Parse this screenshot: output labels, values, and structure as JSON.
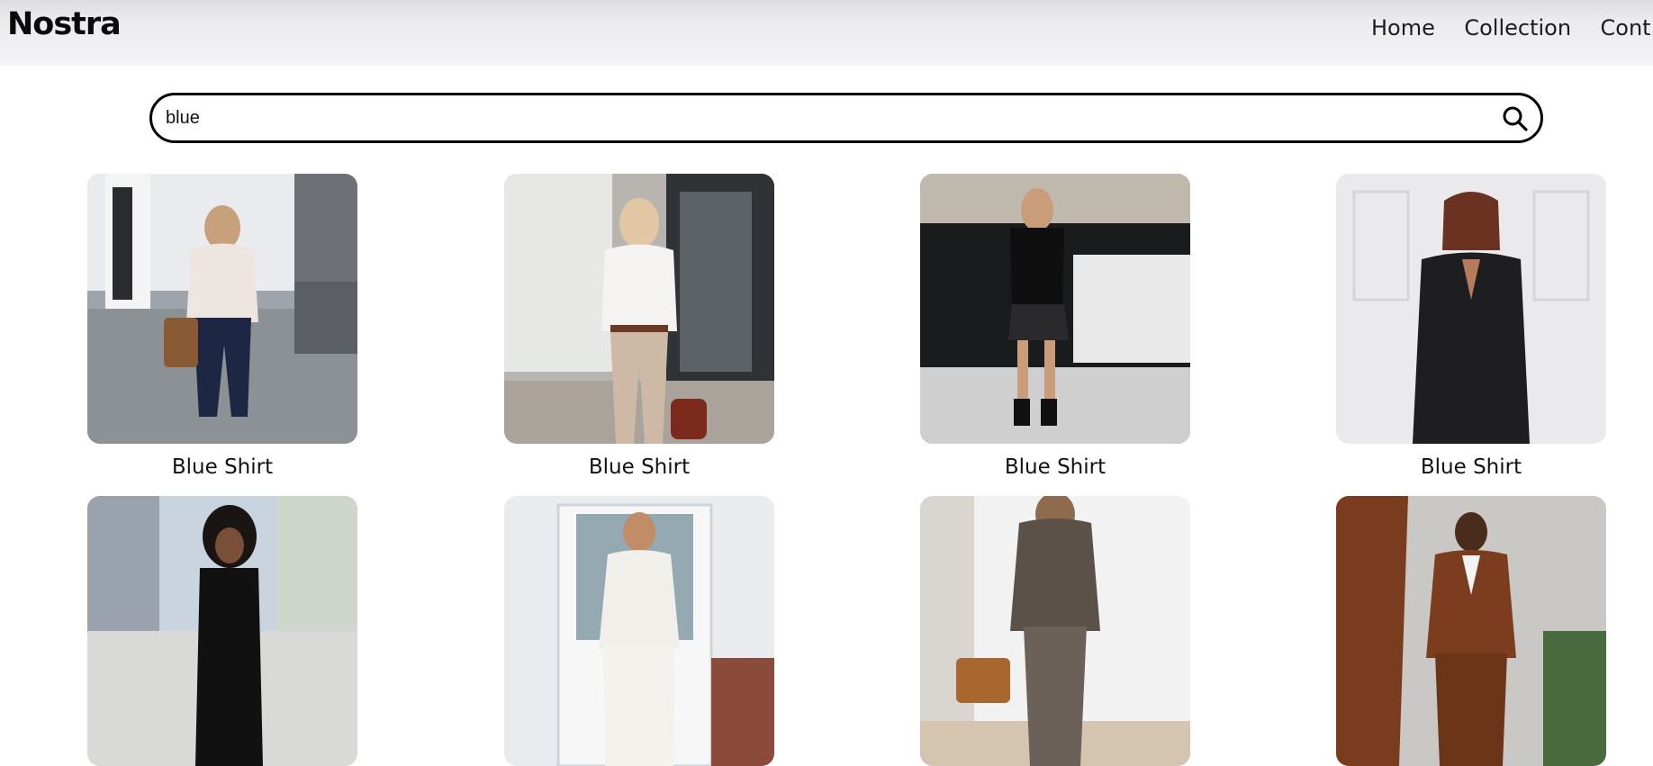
{
  "header": {
    "brand": "Nostra",
    "nav": [
      {
        "label": "Home"
      },
      {
        "label": "Collection"
      },
      {
        "label": "Cont"
      }
    ]
  },
  "search": {
    "value": "blue",
    "icon": "search-icon"
  },
  "products": [
    {
      "title": "Blue Shirt",
      "image": "woman in white blouse and navy trousers with brown handbag"
    },
    {
      "title": "Blue Shirt",
      "image": "blonde woman in white shirt and beige trousers with red bag"
    },
    {
      "title": "Blue Shirt",
      "image": "woman in black top and leather skirt by white car"
    },
    {
      "title": "Blue Shirt",
      "image": "woman in black three-piece suit"
    },
    {
      "title": "",
      "image": "woman in black halter jumpsuit on rooftop"
    },
    {
      "title": "",
      "image": "woman in white blazer and trousers by door"
    },
    {
      "title": "",
      "image": "woman in plaid suit with tan bag"
    },
    {
      "title": "",
      "image": "woman in brown suit outdoors"
    }
  ]
}
